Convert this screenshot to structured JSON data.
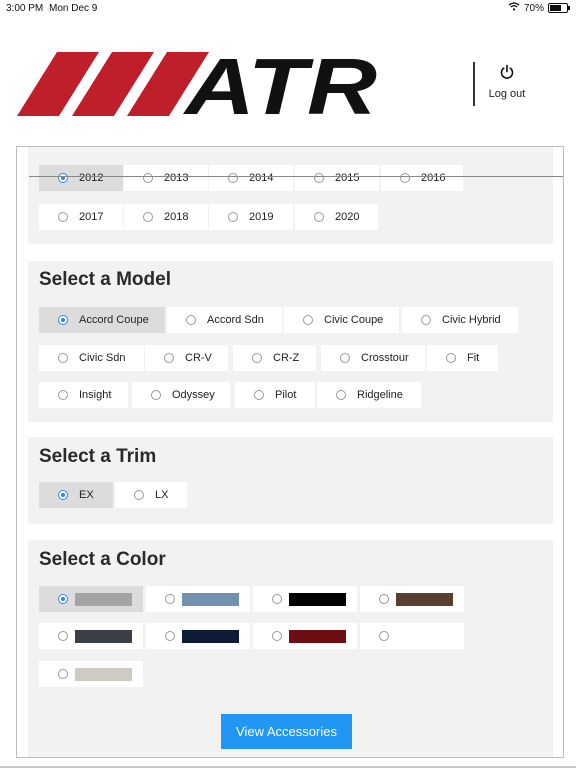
{
  "status_bar": {
    "time": "3:00 PM",
    "date": "Mon Dec 9",
    "battery": "70%"
  },
  "header": {
    "logo_text": "ATR",
    "logout_label": "Log out"
  },
  "year_section": {
    "options": [
      "2012",
      "2013",
      "2014",
      "2015",
      "2016",
      "2017",
      "2018",
      "2019",
      "2020"
    ],
    "selected": "2012"
  },
  "model_section": {
    "title": "Select a Model",
    "options": [
      "Accord Coupe",
      "Accord Sdn",
      "Civic Coupe",
      "Civic Hybrid",
      "Civic Sdn",
      "CR-V",
      "CR-Z",
      "Crosstour",
      "Fit",
      "Insight",
      "Odyssey",
      "Pilot",
      "Ridgeline"
    ],
    "selected": "Accord Coupe"
  },
  "trim_section": {
    "title": "Select a Trim",
    "options": [
      "EX",
      "LX"
    ],
    "selected": "EX"
  },
  "color_section": {
    "title": "Select a Color",
    "swatches": [
      "#a4a4a4",
      "#7291ac",
      "#000000",
      "#583f31",
      "#3b4046",
      "#0d1b36",
      "#6e0e12",
      "#ffffff",
      "#cdcbc4"
    ],
    "selected_index": 0
  },
  "view_accessories_label": "View Accessories"
}
